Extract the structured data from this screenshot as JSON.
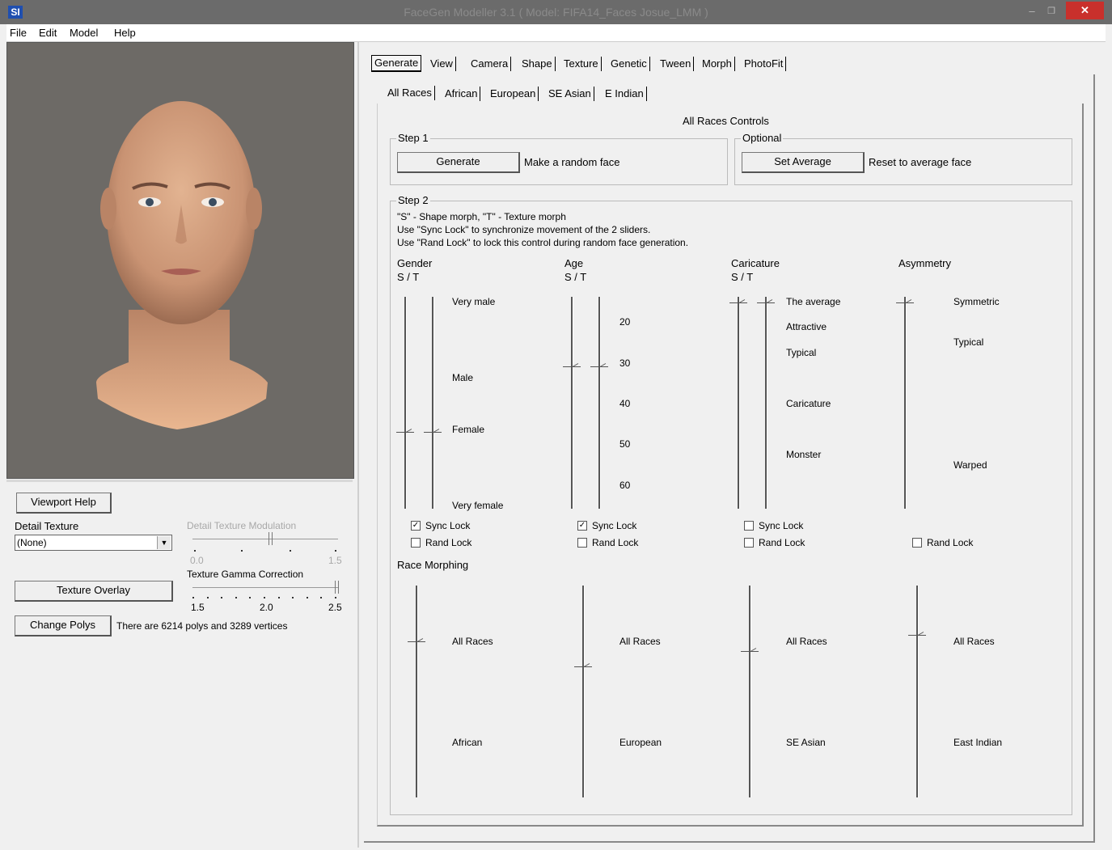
{
  "window": {
    "app_icon": "SI",
    "title": "FaceGen Modeller 3.1  ( Model: FIFA14_Faces Josue_LMM )",
    "min_icon": "minimize-icon",
    "max_icon": "maximize-icon",
    "close_icon": "close-icon"
  },
  "menu": [
    "File",
    "Edit",
    "Model",
    "Help"
  ],
  "left": {
    "viewport_help": "Viewport Help",
    "detail_texture_label": "Detail Texture",
    "detail_texture_value": "(None)",
    "detail_mod_label": "Detail Texture Modulation",
    "detail_mod_min": "0.0",
    "detail_mod_max": "1.5",
    "detail_mod_value": 0.8,
    "gamma_label": "Texture Gamma Correction",
    "gamma_ticks": [
      "1.5",
      "2.0",
      "2.5"
    ],
    "gamma_value": 2.5,
    "texture_overlay": "Texture Overlay",
    "change_polys": "Change Polys",
    "poly_info": "There are 6214 polys and 3289 vertices"
  },
  "tabs": [
    "Generate",
    "View",
    "Camera",
    "Shape",
    "Texture",
    "Genetic",
    "Tween",
    "Morph",
    "PhotoFit"
  ],
  "subtabs": [
    "All Races",
    "African",
    "European",
    "SE Asian",
    "E Indian"
  ],
  "controls_title": "All Races Controls",
  "step1": {
    "title": "Step 1",
    "generate": "Generate",
    "generate_desc": "Make a random face"
  },
  "optional": {
    "title": "Optional",
    "set_average": "Set Average",
    "set_average_desc": "Reset to average face"
  },
  "step2": {
    "title": "Step 2",
    "help": [
      "\"S\" - Shape morph, \"T\" - Texture morph",
      "Use \"Sync Lock\" to synchronize movement of the 2 sliders.",
      "Use \"Rand Lock\" to lock this control during random face generation."
    ],
    "columns": [
      {
        "title": "Gender",
        "sub": "S / T",
        "labels": [
          "Very male",
          "Male",
          "Female",
          "Very female"
        ],
        "value": 0.65,
        "sync_lock": true,
        "has_sync": true,
        "rand_lock": false
      },
      {
        "title": "Age",
        "sub": "S / T",
        "labels": [
          "20",
          "30",
          "40",
          "50",
          "60"
        ],
        "value": 0.32,
        "sync_lock": true,
        "has_sync": true,
        "rand_lock": false
      },
      {
        "title": "Caricature",
        "sub": "S / T",
        "labels": [
          "The average",
          "Attractive",
          "Typical",
          "Caricature",
          "Monster"
        ],
        "value": 0.0,
        "sync_lock": false,
        "has_sync": true,
        "rand_lock": false
      },
      {
        "title": "Asymmetry",
        "sub": "",
        "labels": [
          "Symmetric",
          "Typical",
          "Warped"
        ],
        "value": 0.0,
        "has_sync": false,
        "rand_lock": false
      }
    ],
    "sync_lock_label": "Sync Lock",
    "rand_lock_label": "Rand Lock"
  },
  "race_morphing": {
    "title": "Race Morphing",
    "sliders": [
      {
        "top": "All Races",
        "bottom": "African",
        "value": 0.25
      },
      {
        "top": "All Races",
        "bottom": "European",
        "value": 0.38
      },
      {
        "top": "All Races",
        "bottom": "SE Asian",
        "value": 0.3
      },
      {
        "top": "All Races",
        "bottom": "East Indian",
        "value": 0.22
      }
    ]
  }
}
